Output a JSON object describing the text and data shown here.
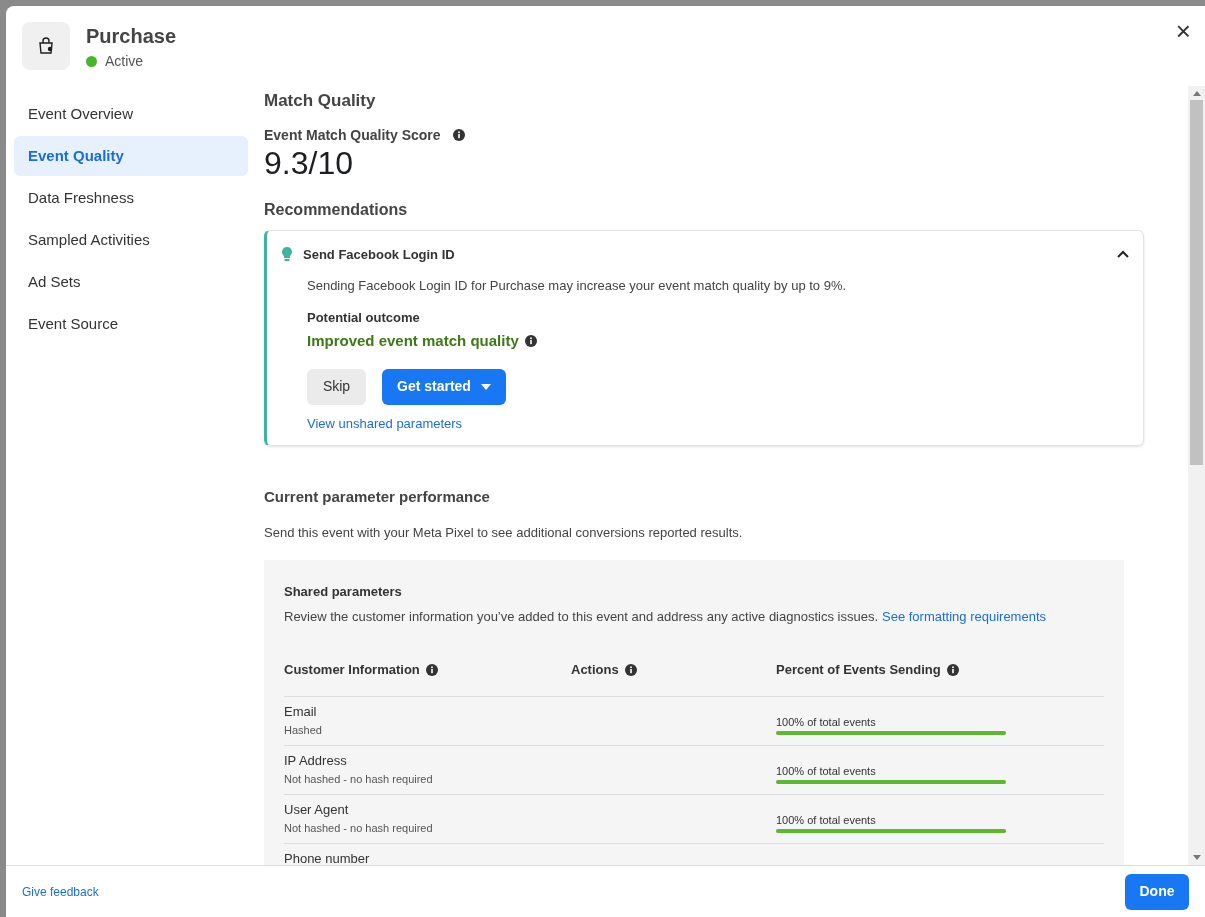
{
  "header": {
    "title": "Purchase",
    "status": {
      "label": "Active",
      "color": "#42b72a"
    }
  },
  "close_button": "×",
  "sidebar": {
    "items": [
      {
        "label": "Event Overview",
        "selected": false
      },
      {
        "label": "Event Quality",
        "selected": true
      },
      {
        "label": "Data Freshness",
        "selected": false
      },
      {
        "label": "Sampled Activities",
        "selected": false
      },
      {
        "label": "Ad Sets",
        "selected": false
      },
      {
        "label": "Event Source",
        "selected": false
      }
    ]
  },
  "match_quality": {
    "title": "Match Quality",
    "score_label": "Event Match Quality Score",
    "score": "9.3/10"
  },
  "recommendations": {
    "title": "Recommendations",
    "items": [
      {
        "title": "Send Facebook Login ID",
        "expanded": true,
        "description": "Sending Facebook Login ID for Purchase may increase your event match quality by up to 9%.",
        "outcome_label": "Potential outcome",
        "outcome": "Improved event match quality",
        "skip": "Skip",
        "primary": "Get started",
        "link": "View unshared parameters"
      }
    ]
  },
  "parameter_performance": {
    "title": "Current parameter performance",
    "description": "Send this event with your Meta Pixel to see additional conversions reported results.",
    "shared": {
      "title": "Shared parameters",
      "description": "Review the customer information you’ve added to this event and address any active diagnostics issues.",
      "link": "See formatting requirements",
      "columns": [
        "Customer Information",
        "Actions",
        "Percent of Events Sending"
      ],
      "rows": [
        {
          "name": "Email",
          "detail": "Hashed",
          "percent": "100% of total events",
          "level": 1
        },
        {
          "name": "IP Address",
          "detail": "Not hashed - no hash required",
          "percent": "100% of total events",
          "level": 1
        },
        {
          "name": "User Agent",
          "detail": "Not hashed - no hash required",
          "percent": "100% of total events",
          "level": 1
        },
        {
          "name": "Phone number"
        }
      ]
    }
  },
  "footer": {
    "feedback": "Give feedback",
    "done": "Done"
  }
}
